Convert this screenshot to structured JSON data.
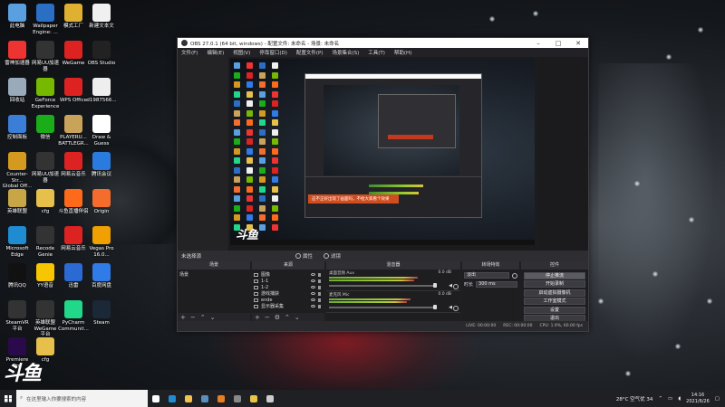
{
  "desktop": {
    "icons": [
      {
        "label": "此电脑",
        "color": "#5aa0e0"
      },
      {
        "label": "Wallpaper\nEngine: ...",
        "color": "#2a6fc4"
      },
      {
        "label": "模式工厂",
        "color": "#e0b030"
      },
      {
        "label": "新建文本文",
        "color": "#f0f0f0"
      },
      {
        "label": "雷神加速器",
        "color": "#e33"
      },
      {
        "label": "网易UU加速器",
        "color": "#333"
      },
      {
        "label": "WeGame",
        "color": "#d22"
      },
      {
        "label": "OBS Studio",
        "color": "#222"
      },
      {
        "label": "回收站",
        "color": "#9ab"
      },
      {
        "label": "GeForce\nExperience",
        "color": "#76b900"
      },
      {
        "label": "WPS Office",
        "color": "#d22"
      },
      {
        "label": "d1987566...",
        "color": "#eee"
      },
      {
        "label": "控制面板",
        "color": "#3b7ed8"
      },
      {
        "label": "微信",
        "color": "#1aad19"
      },
      {
        "label": "PLAYERU...\nBATTLEGR...",
        "color": "#caa35a"
      },
      {
        "label": "Draw &\nGuess",
        "color": "#fff"
      },
      {
        "label": "Counter-Str...\nGlobal Off...",
        "color": "#d49a20"
      },
      {
        "label": "网易UU加速\n器",
        "color": "#333"
      },
      {
        "label": "网易云音乐",
        "color": "#d22"
      },
      {
        "label": "腾讯会议",
        "color": "#2a7be0"
      },
      {
        "label": "英雄联盟",
        "color": "#c8a646"
      },
      {
        "label": "cfg",
        "color": "#e6c04a"
      },
      {
        "label": "斗鱼直播伴侣",
        "color": "#ff6a1a"
      },
      {
        "label": "Origin",
        "color": "#f56c2d"
      },
      {
        "label": "Microsoft\nEdge",
        "color": "#1f8cd2"
      },
      {
        "label": "Recode\nGenie",
        "color": "#333"
      },
      {
        "label": "网易云音乐",
        "color": "#d22"
      },
      {
        "label": "Vegas Pro\n16.0...",
        "color": "#f0a000"
      },
      {
        "label": "腾讯QQ",
        "color": "#111"
      },
      {
        "label": "YY语音",
        "color": "#f7c600"
      },
      {
        "label": "迅雷",
        "color": "#2b6ad2"
      },
      {
        "label": "百度网盘",
        "color": "#2f7be8"
      },
      {
        "label": "SteamVR\n平台",
        "color": "#333"
      },
      {
        "label": "英雄联盟WeGame\n平台",
        "color": "#333"
      },
      {
        "label": "PyCharm\nCommunit...",
        "color": "#21d789"
      },
      {
        "label": "Steam",
        "color": "#1b2838"
      },
      {
        "label": "Premiere\nPro",
        "color": "#2a0a4a"
      },
      {
        "label": "cfg",
        "color": "#e6c04a"
      }
    ],
    "brand_logo": "斗鱼"
  },
  "obs": {
    "title": "OBS 27.0.1 (64 bit, windows) - 配置文件: 未命名 - 场景: 未命名",
    "menu": [
      "文件(F)",
      "编辑(E)",
      "视图(V)",
      "停靠窗口(D)",
      "配置文件(P)",
      "场景集合(S)",
      "工具(T)",
      "帮助(H)"
    ],
    "scene_bar": {
      "name": "未选择源",
      "props": "属性",
      "filters": "滤镜"
    },
    "preview_banner": "这不正好出现了画面吗，不给大家看个效果",
    "preview_brand": "斗鱼",
    "docks": {
      "scenes": {
        "title": "场景",
        "items": [
          "场景"
        ]
      },
      "sources": {
        "title": "来源",
        "items": [
          "图像",
          "1-1",
          "1-2",
          "游戏捕获",
          "ende",
          "显示器采集"
        ]
      },
      "mixer": {
        "title": "混音器",
        "tracks": [
          {
            "name": "桌面音频 Aux",
            "value": "0.0 dB",
            "level": 0.78
          },
          {
            "name": "麦克风 Mic",
            "value": "0.0 dB",
            "level": 0.72
          }
        ]
      },
      "transitions": {
        "title": "转场特效",
        "type": "淡出",
        "duration_label": "时长",
        "duration": "300 ms"
      },
      "controls": {
        "title": "控件",
        "buttons": [
          "停止推流",
          "开始录制",
          "启动虚拟摄像机",
          "工作室模式",
          "设置",
          "退出"
        ]
      }
    },
    "status": {
      "live": "LIVE: 00:00:00",
      "rec": "REC: 00:00:00",
      "cpu": "CPU: 1.9%, 60.00 fps"
    }
  },
  "taskbar": {
    "search_placeholder": "在这里输入你要搜索的内容",
    "weather": "28°C 空气优 34",
    "time": "14:16",
    "date": "2021/6/26",
    "apps": [
      {
        "name": "task-view",
        "color": "#fff"
      },
      {
        "name": "edge",
        "color": "#1f8cd2"
      },
      {
        "name": "file-explorer",
        "color": "#f2c14e"
      },
      {
        "name": "steam",
        "color": "#5a8ebd"
      },
      {
        "name": "app-orange",
        "color": "#e67e22"
      },
      {
        "name": "app-grey",
        "color": "#888"
      },
      {
        "name": "app-yellow",
        "color": "#e8c547"
      },
      {
        "name": "obs",
        "color": "#ccc"
      }
    ]
  }
}
